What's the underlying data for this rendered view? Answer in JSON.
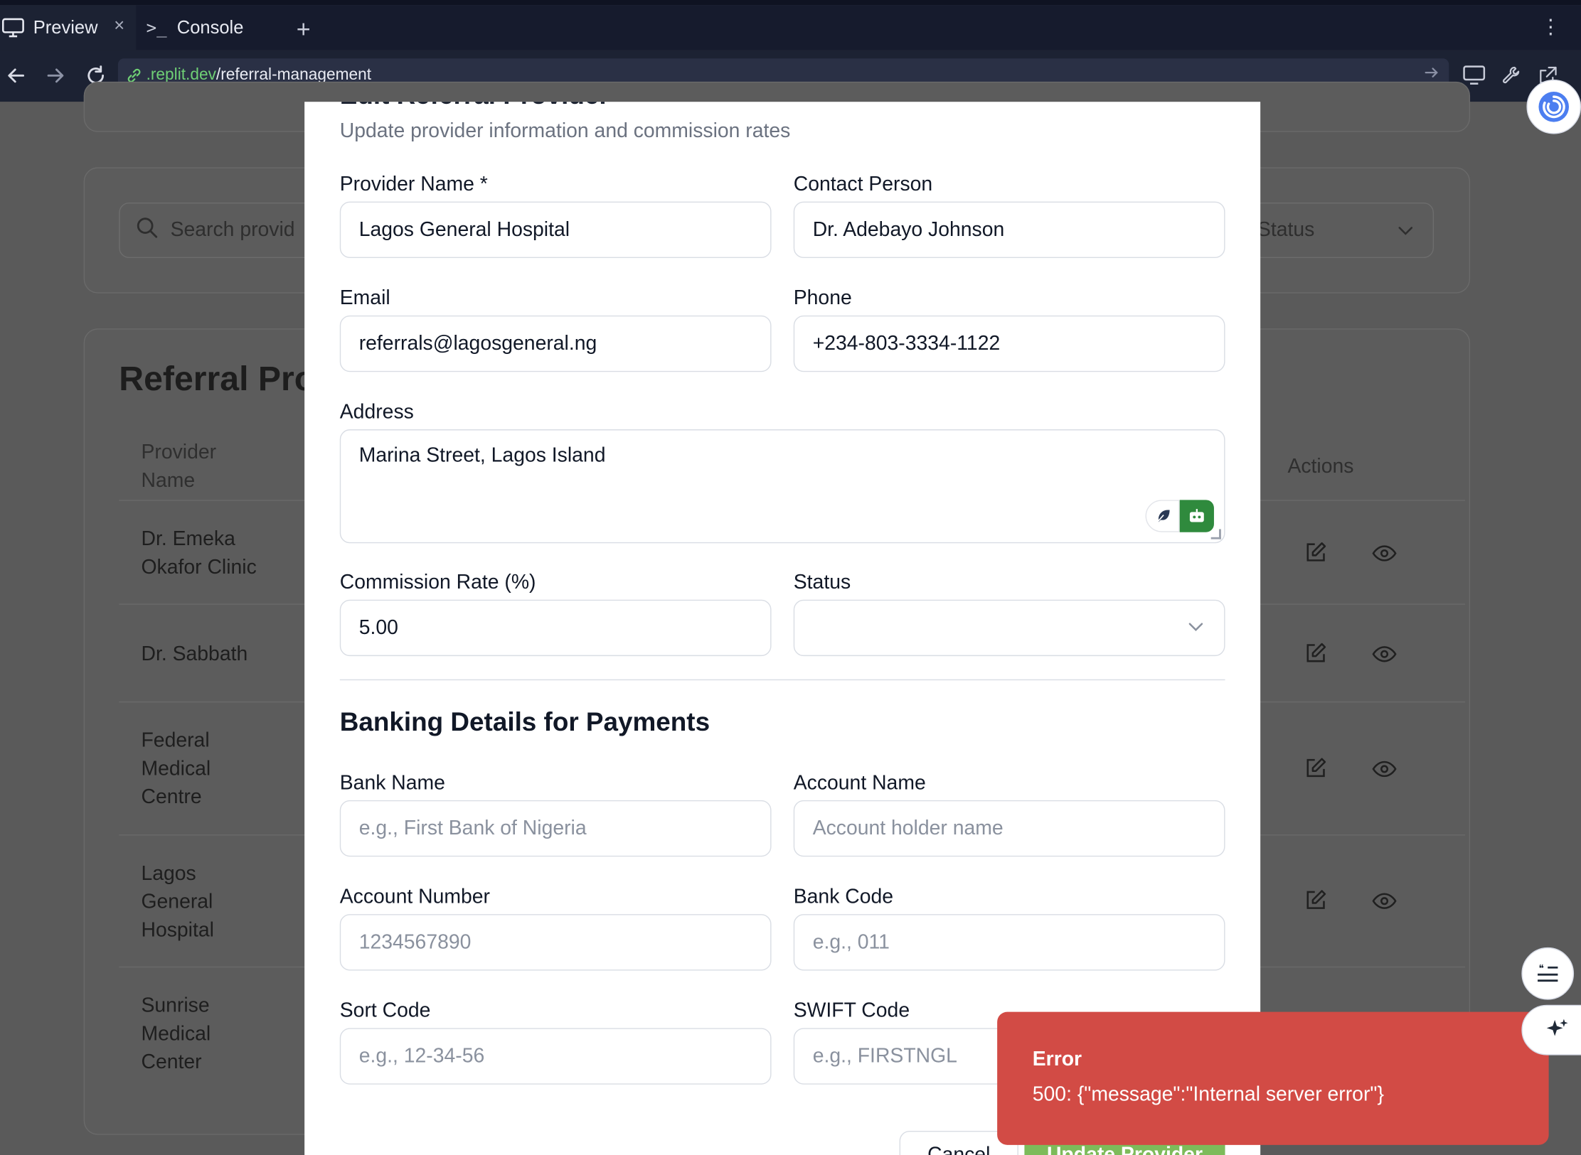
{
  "browser": {
    "tabs": [
      {
        "label": "Preview",
        "icon": "monitor-icon",
        "active": true
      },
      {
        "label": "Console",
        "icon": "terminal-icon",
        "active": false
      }
    ],
    "new_tab": "+",
    "menu": "⋮",
    "url_host": ".replit.dev",
    "url_path": "/referral-management"
  },
  "background": {
    "search_placeholder": "Search provid",
    "status_filter": "Status",
    "list_title": "Referral Prov",
    "col_provider": "Provider Name",
    "col_actions": "Actions",
    "rows": [
      {
        "name": "Dr. Emeka Okafor Clinic"
      },
      {
        "name": "Dr. Sabbath"
      },
      {
        "name": "Federal Medical Centre"
      },
      {
        "name": "Lagos General Hospital"
      },
      {
        "name": "Sunrise Medical Center"
      }
    ]
  },
  "modal": {
    "title": "Edit Referral Provider",
    "subtitle": "Update provider information and commission rates",
    "fields": {
      "provider_name": {
        "label": "Provider Name *",
        "value": "Lagos General Hospital"
      },
      "contact_person": {
        "label": "Contact Person",
        "value": "Dr. Adebayo Johnson"
      },
      "email": {
        "label": "Email",
        "value": "referrals@lagosgeneral.ng"
      },
      "phone": {
        "label": "Phone",
        "value": "+234-803-3334-1122"
      },
      "address": {
        "label": "Address",
        "value": "Marina Street, Lagos Island"
      },
      "commission_rate": {
        "label": "Commission Rate (%)",
        "value": "5.00"
      },
      "status": {
        "label": "Status",
        "value": ""
      }
    },
    "banking_title": "Banking Details for Payments",
    "banking": {
      "bank_name": {
        "label": "Bank Name",
        "placeholder": "e.g., First Bank of Nigeria"
      },
      "account_name": {
        "label": "Account Name",
        "placeholder": "Account holder name"
      },
      "account_number": {
        "label": "Account Number",
        "placeholder": "1234567890"
      },
      "bank_code": {
        "label": "Bank Code",
        "placeholder": "e.g., 011"
      },
      "sort_code": {
        "label": "Sort Code",
        "placeholder": "e.g., 12-34-56"
      },
      "swift_code": {
        "label": "SWIFT Code",
        "placeholder": "e.g., FIRSTNGL"
      }
    },
    "cancel_label": "Cancel",
    "update_label": "Update Provider"
  },
  "toast": {
    "title": "Error",
    "message": "500: {\"message\":\"Internal server error\"}",
    "color": "#d24b45"
  },
  "colors": {
    "accent_green": "#6fcf75",
    "modal_bg": "#ffffff",
    "chrome_bg": "#1c2233"
  }
}
